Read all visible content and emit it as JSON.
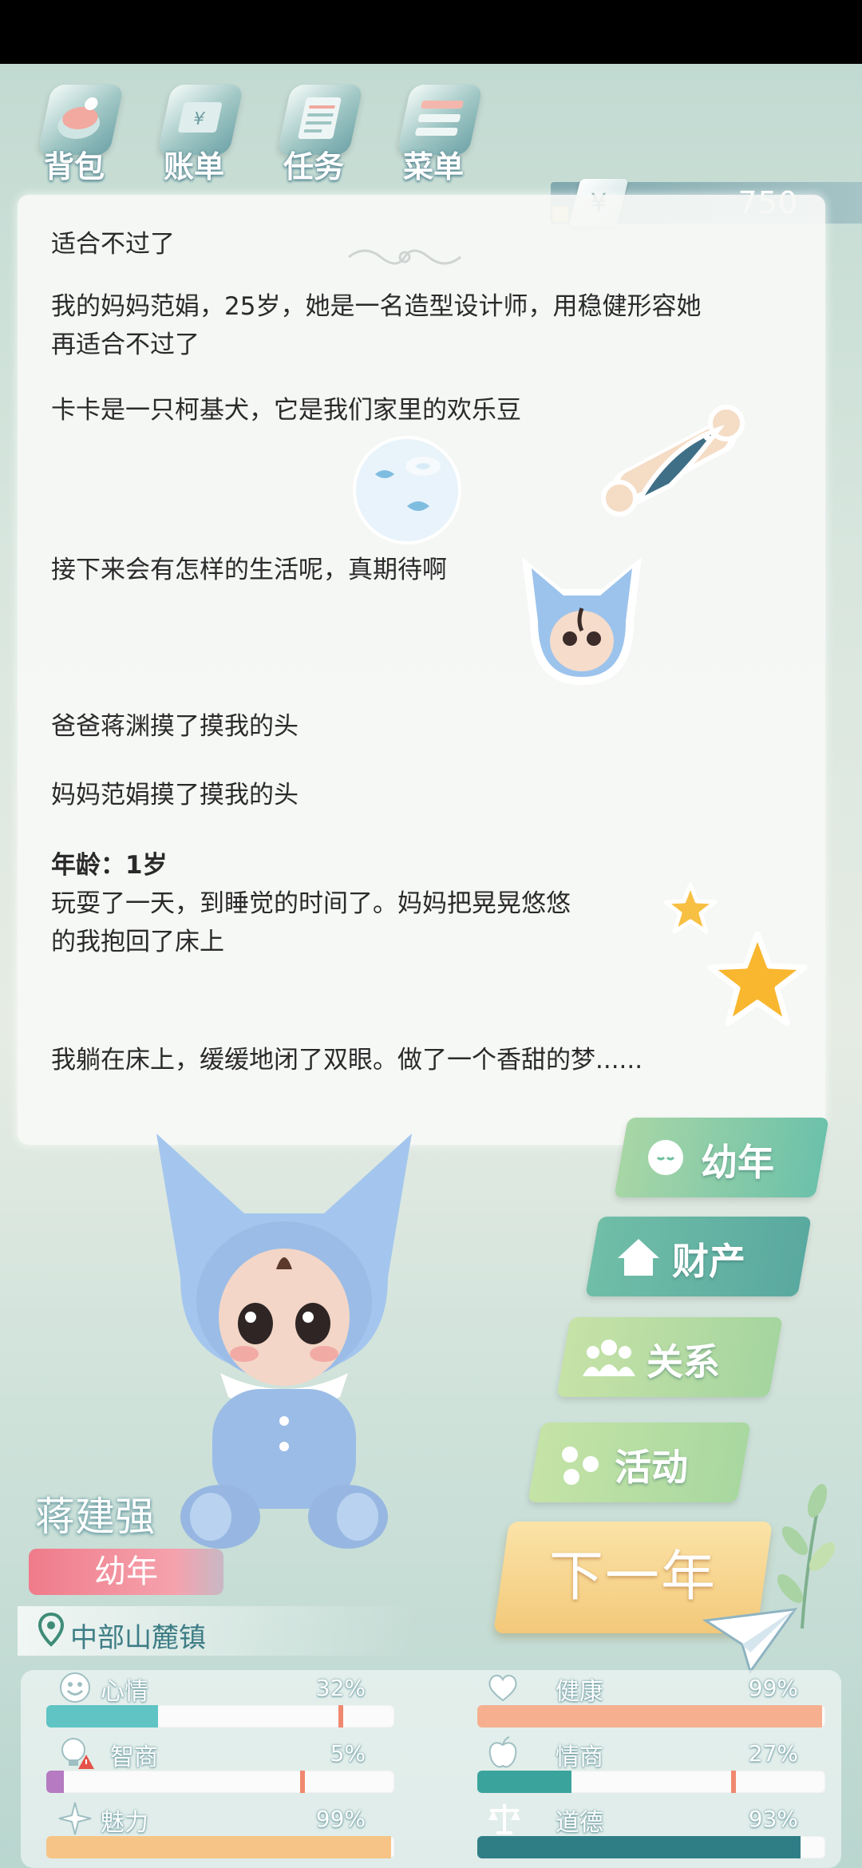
{
  "toolbar": {
    "bag": "背包",
    "bill": "账单",
    "task": "任务",
    "menu": "菜单"
  },
  "money": {
    "symbol": "¥",
    "amount": "750"
  },
  "story": {
    "lines": [
      "适合不过了",
      "我的妈妈范娟，25岁，她是一名造型设计师，用稳健形容她",
      "再适合不过了",
      "卡卡是一只柯基犬，它是我们家里的欢乐豆",
      "接下来会有怎样的生活呢，真期待啊",
      "爸爸蒋渊摸了摸我的头",
      "妈妈范娟摸了摸我的头",
      "年龄：1岁",
      "玩耍了一天，到睡觉的时间了。妈妈把晃晃悠悠",
      "的我抱回了床上",
      "我躺在床上，缓缓地闭了双眼。做了一个香甜的梦......"
    ]
  },
  "character": {
    "name": "蒋建强",
    "stage": "幼年",
    "location": "中部山麓镇"
  },
  "actions": {
    "young": "幼年",
    "asset": "财产",
    "relation": "关系",
    "activity": "活动",
    "next_year": "下一年"
  },
  "stats": [
    {
      "label": "心情",
      "value": "32%",
      "level": 0.32,
      "marker": 0.84,
      "color": "#5fc4c3"
    },
    {
      "label": "健康",
      "value": "99%",
      "level": 0.99,
      "marker": null,
      "color": "#f6b08f"
    },
    {
      "label": "智商",
      "value": "5%",
      "level": 0.05,
      "marker": 0.73,
      "color": "#b57ac1"
    },
    {
      "label": "情商",
      "value": "27%",
      "level": 0.27,
      "marker": 0.73,
      "color": "#3aa39b"
    },
    {
      "label": "魅力",
      "value": "99%",
      "level": 0.99,
      "marker": null,
      "color": "#f6c486"
    },
    {
      "label": "道德",
      "value": "93%",
      "level": 0.93,
      "marker": null,
      "color": "#2f7e86"
    }
  ]
}
